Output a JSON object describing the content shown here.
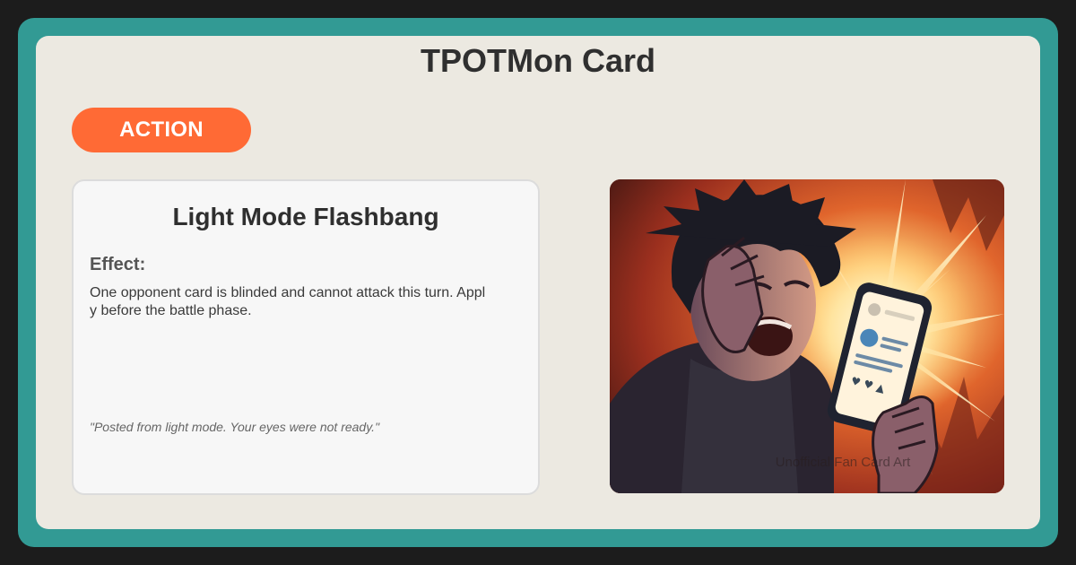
{
  "page_title": "TPOTMon Card",
  "card": {
    "type_badge": "ACTION",
    "name": "Light Mode Flashbang",
    "effect_heading": "Effect:",
    "effect_text": "One opponent card is blinded and cannot attack this turn. Apply before the battle phase.",
    "flavor_text": "\"Posted from light mode. Your eyes were not ready.\"",
    "illustration": {
      "description_icon": "man-shielding-eyes-from-bright-phone-icon",
      "watermark": "Unofficial Fan Card Art"
    }
  },
  "colors": {
    "outer_background": "#1c1c1c",
    "frame": "#329a94",
    "card_surface": "#ece9e1",
    "badge": "#ff6a35",
    "panel": "#f7f7f7"
  }
}
